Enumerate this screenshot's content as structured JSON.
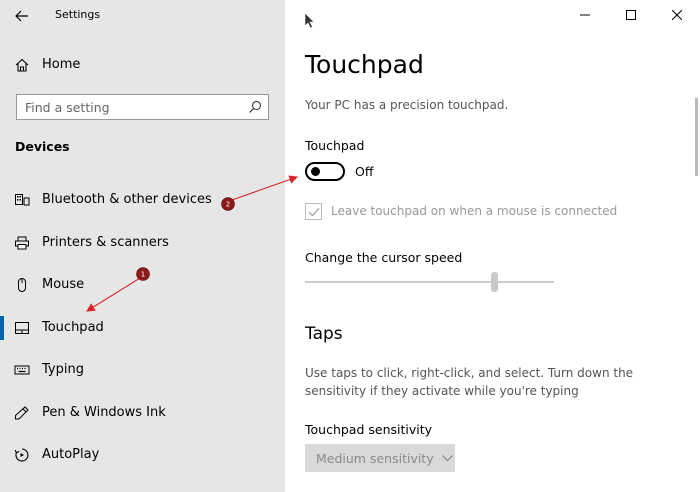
{
  "window": {
    "title": "Settings"
  },
  "sidebar": {
    "home_label": "Home",
    "search_placeholder": "Find a setting",
    "section": "Devices",
    "items": [
      {
        "label": "Bluetooth & other devices",
        "icon": "bluetooth-keyboard-icon",
        "active": false
      },
      {
        "label": "Printers & scanners",
        "icon": "printer-icon",
        "active": false
      },
      {
        "label": "Mouse",
        "icon": "mouse-icon",
        "active": false
      },
      {
        "label": "Touchpad",
        "icon": "touchpad-icon",
        "active": true
      },
      {
        "label": "Typing",
        "icon": "keyboard-icon",
        "active": false
      },
      {
        "label": "Pen & Windows Ink",
        "icon": "pen-icon",
        "active": false
      },
      {
        "label": "AutoPlay",
        "icon": "autoplay-icon",
        "active": false
      }
    ]
  },
  "main": {
    "title": "Touchpad",
    "info": "Your PC has a precision touchpad.",
    "touchpad_label": "Touchpad",
    "toggle_state": "Off",
    "checkbox_label": "Leave touchpad on when a mouse is connected",
    "checkbox_checked": true,
    "cursor_speed_label": "Change the cursor speed",
    "cursor_speed_fraction": 0.77,
    "taps_heading": "Taps",
    "taps_description": "Use taps to click, right-click, and select. Turn down the sensitivity if they activate while you're typing",
    "sensitivity_label": "Touchpad sensitivity",
    "sensitivity_value": "Medium sensitivity"
  },
  "annotations": {
    "badge_1": "1",
    "badge_2": "2",
    "color": "#d9262d"
  },
  "colors": {
    "sidebar_bg": "#e6e6e6",
    "accent": "#0063b1"
  }
}
